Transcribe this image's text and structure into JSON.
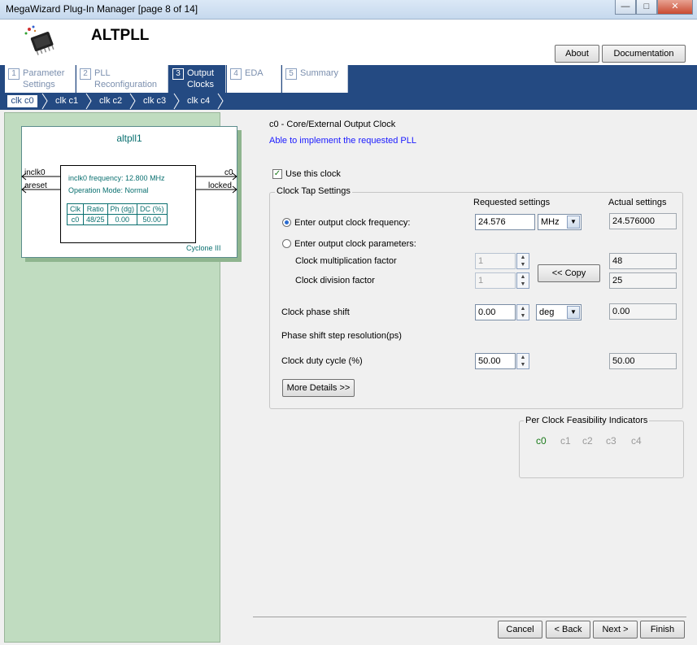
{
  "window": {
    "title": "MegaWizard Plug-In Manager [page 8 of 14]",
    "min": "—",
    "max": "□",
    "close": "✕"
  },
  "header": {
    "app_title": "ALTPLL",
    "about": "About",
    "documentation": "Documentation"
  },
  "tabs": [
    {
      "num": "1",
      "label": "Parameter Settings"
    },
    {
      "num": "2",
      "label": "PLL Reconfiguration"
    },
    {
      "num": "3",
      "label": "Output Clocks"
    },
    {
      "num": "4",
      "label": "EDA"
    },
    {
      "num": "5",
      "label": "Summary"
    }
  ],
  "clock_tabs": [
    "clk c0",
    "clk c1",
    "clk c2",
    "clk c3",
    "clk c4"
  ],
  "diagram": {
    "title": "altpll1",
    "in1": "inclk0",
    "in2": "areset",
    "out1": "c0",
    "out2": "locked",
    "freq": "inclk0 frequency: 12.800 MHz",
    "mode": "Operation Mode: Normal",
    "table_head": [
      "Clk",
      "Ratio",
      "Ph (dg)",
      "DC (%)"
    ],
    "table_row": [
      "c0",
      "48/25",
      "0.00",
      "50.00"
    ],
    "device": "Cyclone III"
  },
  "main": {
    "heading": "c0 - Core/External Output Clock",
    "status": "Able to implement the requested PLL",
    "use_clock": "Use this clock",
    "group_title": "Clock Tap Settings",
    "requested": "Requested settings",
    "actual": "Actual settings",
    "opt_freq": "Enter output clock frequency:",
    "freq_value": "24.576",
    "freq_unit": "MHz",
    "freq_actual": "24.576000",
    "opt_params": "Enter output clock parameters:",
    "mult_label": "Clock multiplication factor",
    "mult_value": "1",
    "mult_actual": "48",
    "div_label": "Clock division factor",
    "div_value": "1",
    "div_actual": "25",
    "copy": "<< Copy",
    "phase_label": "Clock phase shift",
    "phase_value": "0.00",
    "phase_unit": "deg",
    "phase_actual": "0.00",
    "step_label": "Phase shift step resolution(ps)",
    "duty_label": "Clock duty cycle (%)",
    "duty_value": "50.00",
    "duty_actual": "50.00",
    "more": "More Details >>"
  },
  "feasibility": {
    "title": "Per Clock Feasibility Indicators",
    "items": [
      "c0",
      "c1",
      "c2",
      "c3",
      "c4"
    ],
    "ok_color": "#1a7a1a",
    "dim_color": "#9a9a9a"
  },
  "footer": {
    "cancel": "Cancel",
    "back": "< Back",
    "next": "Next >",
    "finish": "Finish"
  }
}
